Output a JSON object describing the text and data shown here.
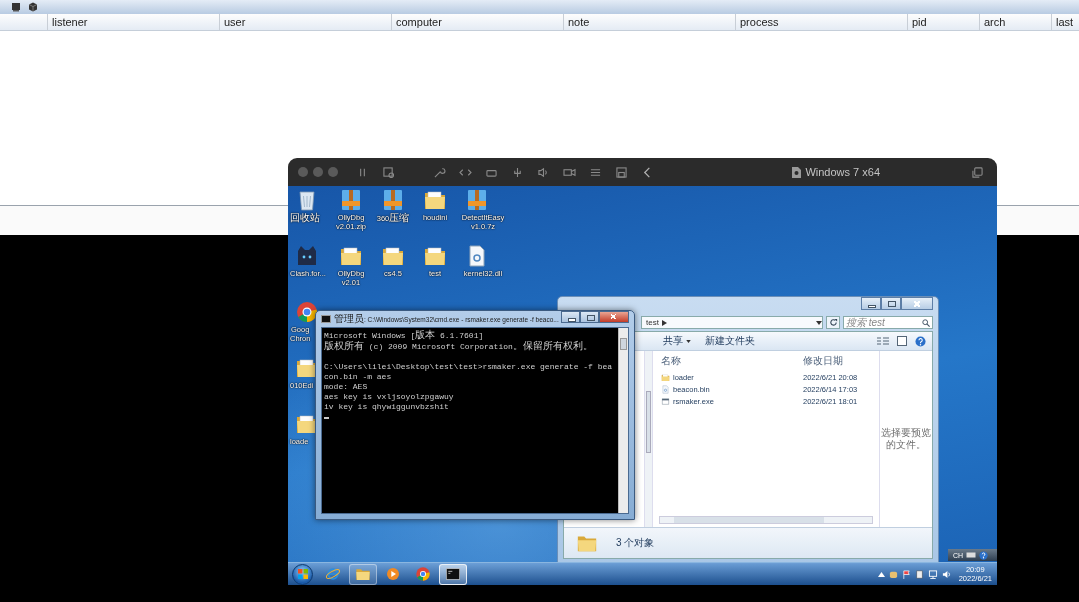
{
  "app_table": {
    "columns": [
      "listener",
      "user",
      "computer",
      "note",
      "process",
      "pid",
      "arch",
      "last"
    ]
  },
  "vm_window": {
    "title": "Windows 7 x64",
    "desktop_icons": [
      [
        {
          "kind": "recycle-bin",
          "label": "回收站"
        },
        {
          "kind": "cat-app",
          "label": "Clash.for..."
        },
        {
          "kind": "chrome",
          "label": "Goog Chron"
        },
        {
          "kind": "folder",
          "label": "010Edi"
        },
        {
          "kind": "folder",
          "label": "loade"
        }
      ],
      [
        {
          "kind": "archive",
          "label": "OllyDbg v2.01.zip"
        },
        {
          "kind": "folder",
          "label": "OllyDbg v2.01"
        }
      ],
      [
        {
          "kind": "archive",
          "label": "360压缩"
        },
        {
          "kind": "folder",
          "label": "cs4.5"
        }
      ],
      [
        {
          "kind": "folder",
          "label": "houdini"
        },
        {
          "kind": "folder",
          "label": "test"
        }
      ],
      [
        {
          "kind": "archive",
          "label": "DetectItEasy v1.0.7z"
        },
        {
          "kind": "file",
          "label": "kernel32.dll"
        }
      ]
    ],
    "cmd_window": {
      "title": "管理员: C:\\Windows\\System32\\cmd.exe - rsmaker.exe generate -f beaco...",
      "blocks": [
        [
          "Microsoft Windows [版本 6.1.7601]",
          "版权所有 (c) 2009 Microsoft Corporation。保留所有权利。"
        ],
        [
          "C:\\Users\\lilei\\Desktop\\test\\test>rsmaker.exe generate -f beacon.bin -m aes",
          "mode: AES",
          "aes key is vxljsoyolzpgawuy",
          "iv key is qhywiggunvbzshit"
        ]
      ]
    },
    "explorer": {
      "address": "test",
      "search": {
        "placeholder": "搜索 test"
      },
      "toolbar": [
        {
          "label": "共享",
          "dropdown": true
        },
        {
          "label": "新建文件夹",
          "dropdown": false
        }
      ],
      "columns": [
        "名称",
        "修改日期"
      ],
      "files": [
        {
          "kind": "folder",
          "name": "loader",
          "modified": "2022/6/21 20:08"
        },
        {
          "kind": "file",
          "name": "beacon.bin",
          "modified": "2022/6/14 17:03"
        },
        {
          "kind": "exe",
          "name": "rsmaker.exe",
          "modified": "2022/6/21 18:01"
        }
      ],
      "preview_hint": "选择要预览的文件。",
      "status": "3 个对象"
    },
    "language_bar": {
      "label": "CH"
    },
    "taskbar": {
      "apps": [
        {
          "kind": "ie",
          "running": false,
          "selected": false
        },
        {
          "kind": "explorer",
          "running": true,
          "selected": false
        },
        {
          "kind": "media-player",
          "running": false,
          "selected": false
        },
        {
          "kind": "chrome",
          "running": false,
          "selected": false
        },
        {
          "kind": "cmd",
          "running": true,
          "selected": true
        }
      ],
      "time": "20:09",
      "date": "2022/6/21"
    }
  }
}
